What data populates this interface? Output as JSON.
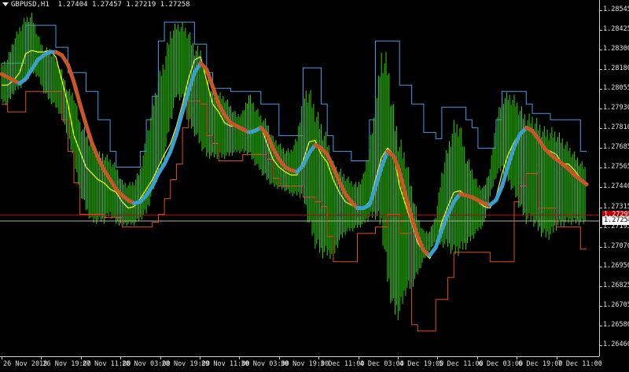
{
  "header": {
    "symbol_timeframe": "GBPUSD,H1",
    "ohlc": "1.27404 1.27457 1.27219 1.27258"
  },
  "price_axis": {
    "ticks": [
      "1.28545",
      "1.28425",
      "1.28300",
      "1.28180",
      "1.28055",
      "1.27930",
      "1.27810",
      "1.27685",
      "1.27565",
      "1.27440",
      "1.27315",
      "1.27195",
      "1.27070",
      "1.26950",
      "1.26825",
      "1.26705",
      "1.26580",
      "1.26460"
    ],
    "bid_label": "1.27258",
    "alert_label": "1.27295"
  },
  "time_axis": {
    "ticks": [
      "26 Nov 2018",
      "26 Nov 19:00",
      "27 Nov 11:00",
      "28 Nov 03:00",
      "28 Nov 19:00",
      "29 Nov 11:00",
      "30 Nov 03:00",
      "30 Nov 19:00",
      "3 Dec 11:00",
      "4 Dec 03:00",
      "4 Dec 19:00",
      "5 Dec 11:00",
      "6 Dec 03:00",
      "6 Dec 19:00",
      "7 Dec 11:00"
    ]
  },
  "colors": {
    "background": "#000000",
    "bars": "#2fd400",
    "yellow_band": "#ffff00",
    "blue_upper": "#3aa0e6",
    "red_lower": "#e0501a",
    "ma_orange": "#c8562a",
    "ma_blue": "#3a9dd4",
    "bid_line": "#b0b0b0",
    "alert_line": "#c00000",
    "axis_text": "#e0e0e0"
  },
  "chart_data": {
    "type": "line",
    "symbol": "GBPUSD",
    "timeframe": "H1",
    "y_range": [
      1.264,
      1.2866
    ],
    "x_labels": [
      "26 Nov 2018",
      "26 Nov 19:00",
      "27 Nov 11:00",
      "28 Nov 03:00",
      "28 Nov 19:00",
      "29 Nov 11:00",
      "30 Nov 03:00",
      "30 Nov 19:00",
      "3 Dec 11:00",
      "4 Dec 03:00",
      "4 Dec 19:00",
      "5 Dec 11:00",
      "6 Dec 03:00",
      "6 Dec 19:00",
      "7 Dec 11:00"
    ],
    "horizontal_lines": [
      {
        "name": "bid",
        "value": 1.27258
      },
      {
        "name": "alert",
        "value": 1.27295
      }
    ],
    "series": [
      {
        "kind": "ma_thick",
        "values": [
          1.2819,
          1.2817,
          1.2815,
          1.2813,
          1.2816,
          1.2822,
          1.2828,
          1.2831,
          1.2833,
          1.2833,
          1.2831,
          1.2825,
          1.2814,
          1.28,
          1.2787,
          1.2775,
          1.2766,
          1.2758,
          1.2752,
          1.2746,
          1.2742,
          1.2739,
          1.2737,
          1.2738,
          1.2742,
          1.2748,
          1.2756,
          1.2762,
          1.277,
          1.2781,
          1.2795,
          1.2808,
          1.282,
          1.2826,
          1.2822,
          1.2811,
          1.28,
          1.2793,
          1.2788,
          1.2786,
          1.2784,
          1.2782,
          1.2783,
          1.2785,
          1.2781,
          1.2772,
          1.2765,
          1.276,
          1.2758,
          1.2757,
          1.2761,
          1.2769,
          1.2774,
          1.2772,
          1.2768,
          1.276,
          1.2751,
          1.2743,
          1.2738,
          1.2734,
          1.2734,
          1.2736,
          1.2747,
          1.276,
          1.277,
          1.2767,
          1.2757,
          1.2742,
          1.2728,
          1.2716,
          1.2707,
          1.2704,
          1.2709,
          1.272,
          1.273,
          1.2738,
          1.2743,
          1.2742,
          1.2741,
          1.2739,
          1.2737,
          1.2736,
          1.2739,
          1.2748,
          1.2761,
          1.2773,
          1.2781,
          1.2785,
          1.2783,
          1.2778,
          1.2772,
          1.2768,
          1.2765,
          1.2762,
          1.2759,
          1.2755,
          1.2752,
          1.2749
        ]
      },
      {
        "kind": "yellow_band",
        "values": [
          1.2812,
          1.2812,
          1.2815,
          1.282,
          1.2832,
          1.2834,
          1.2833,
          1.2833,
          1.2834,
          1.283,
          1.2815,
          1.28,
          1.278,
          1.277,
          1.276,
          1.2756,
          1.2752,
          1.275,
          1.2746,
          1.2744,
          1.2738,
          1.2734,
          1.2735,
          1.274,
          1.2746,
          1.2752,
          1.276,
          1.2768,
          1.2775,
          1.2786,
          1.28,
          1.2816,
          1.2828,
          1.283,
          1.2815,
          1.28,
          1.2795,
          1.2788,
          1.2786,
          1.2786,
          1.2784,
          1.2782,
          1.2784,
          1.2786,
          1.2775,
          1.2765,
          1.276,
          1.2757,
          1.2755,
          1.2755,
          1.2764,
          1.2776,
          1.2777,
          1.2768,
          1.2763,
          1.2752,
          1.2744,
          1.2738,
          1.2736,
          1.2734,
          1.2734,
          1.2738,
          1.2752,
          1.2766,
          1.2772,
          1.2768,
          1.2748,
          1.2736,
          1.2724,
          1.2712,
          1.2706,
          1.2702,
          1.271,
          1.2725,
          1.2735,
          1.2744,
          1.2745,
          1.2742,
          1.274,
          1.2738,
          1.2735,
          1.2734,
          1.2741,
          1.2756,
          1.2768,
          1.2776,
          1.2782,
          1.2786,
          1.2784,
          1.2779,
          1.2772,
          1.277,
          1.2768,
          1.2762,
          1.2762,
          1.2758,
          1.2753,
          1.275
        ]
      },
      {
        "kind": "upper_band",
        "values": [
          1.2826,
          1.2826,
          1.2826,
          1.2826,
          1.285,
          1.285,
          1.285,
          1.285,
          1.285,
          1.2836,
          1.2836,
          1.282,
          1.282,
          1.282,
          1.2808,
          1.2808,
          1.279,
          1.279,
          1.277,
          1.276,
          1.276,
          1.276,
          1.276,
          1.277,
          1.279,
          1.2805,
          1.284,
          1.2852,
          1.2852,
          1.2852,
          1.2852,
          1.2852,
          1.2838,
          1.2838,
          1.282,
          1.281,
          1.281,
          1.281,
          1.2808,
          1.2808,
          1.2808,
          1.2808,
          1.2808,
          1.28,
          1.28,
          1.28,
          1.278,
          1.278,
          1.278,
          1.278,
          1.2823,
          1.2823,
          1.2823,
          1.28,
          1.278,
          1.277,
          1.277,
          1.277,
          1.2764,
          1.2764,
          1.2764,
          1.279,
          1.284,
          1.284,
          1.284,
          1.284,
          1.2812,
          1.2812,
          1.28,
          1.28,
          1.2782,
          1.2782,
          1.2778,
          1.2798,
          1.2798,
          1.2798,
          1.2798,
          1.279,
          1.2785,
          1.2772,
          1.2772,
          1.2772,
          1.279,
          1.2808,
          1.2808,
          1.2808,
          1.2808,
          1.28,
          1.2794,
          1.2794,
          1.2794,
          1.279,
          1.279,
          1.279,
          1.279,
          1.279,
          1.277,
          1.277
        ]
      },
      {
        "kind": "lower_band",
        "values": [
          1.28,
          1.2795,
          1.2795,
          1.2795,
          1.2808,
          1.2808,
          1.2808,
          1.2808,
          1.2808,
          1.2808,
          1.279,
          1.277,
          1.275,
          1.273,
          1.273,
          1.273,
          1.273,
          1.2728,
          1.2728,
          1.2728,
          1.2722,
          1.2722,
          1.2722,
          1.2722,
          1.2722,
          1.2725,
          1.273,
          1.274,
          1.2752,
          1.2762,
          1.2785,
          1.2802,
          1.2802,
          1.28,
          1.278,
          1.2775,
          1.2764,
          1.2764,
          1.2764,
          1.2764,
          1.2768,
          1.2768,
          1.2768,
          1.2768,
          1.2765,
          1.2753,
          1.2748,
          1.2748,
          1.2748,
          1.2748,
          1.2741,
          1.2741,
          1.2738,
          1.2735,
          1.2716,
          1.27,
          1.27,
          1.27,
          1.27,
          1.2718,
          1.2718,
          1.2718,
          1.2722,
          1.2722,
          1.273,
          1.273,
          1.2718,
          1.2718,
          1.266,
          1.2656,
          1.2656,
          1.2656,
          1.2676,
          1.2676,
          1.269,
          1.2706,
          1.2706,
          1.2706,
          1.2706,
          1.2706,
          1.2706,
          1.27,
          1.27,
          1.27,
          1.27,
          1.2738,
          1.2748,
          1.2756,
          1.2756,
          1.2734,
          1.2734,
          1.2734,
          1.2722,
          1.2722,
          1.2722,
          1.2722,
          1.2708,
          1.2708
        ]
      },
      {
        "kind": "bars_high",
        "values": [
          1.2826,
          1.283,
          1.2842,
          1.285,
          1.2856,
          1.2858,
          1.2845,
          1.2836,
          1.2836,
          1.283,
          1.2822,
          1.281,
          1.2808,
          1.279,
          1.2784,
          1.2776,
          1.277,
          1.277,
          1.2766,
          1.2762,
          1.2752,
          1.275,
          1.2752,
          1.276,
          1.278,
          1.28,
          1.2818,
          1.283,
          1.2848,
          1.2852,
          1.2852,
          1.2848,
          1.2838,
          1.2836,
          1.282,
          1.2808,
          1.2808,
          1.2806,
          1.28,
          1.2794,
          1.2796,
          1.2808,
          1.28,
          1.2794,
          1.279,
          1.278,
          1.2776,
          1.2772,
          1.2772,
          1.278,
          1.281,
          1.2812,
          1.28,
          1.279,
          1.278,
          1.2764,
          1.276,
          1.2756,
          1.2752,
          1.275,
          1.2756,
          1.2774,
          1.28,
          1.2836,
          1.2832,
          1.28,
          1.278,
          1.277,
          1.275,
          1.273,
          1.272,
          1.272,
          1.273,
          1.2758,
          1.2775,
          1.279,
          1.279,
          1.277,
          1.276,
          1.275,
          1.2748,
          1.276,
          1.279,
          1.2806,
          1.2808,
          1.2806,
          1.28,
          1.2794,
          1.2794,
          1.279,
          1.2786,
          1.2786,
          1.2784,
          1.278,
          1.2775,
          1.277,
          1.2765,
          1.276
        ]
      },
      {
        "kind": "bars_low",
        "values": [
          1.28,
          1.2798,
          1.2805,
          1.2808,
          1.2812,
          1.2818,
          1.2816,
          1.2806,
          1.28,
          1.2796,
          1.279,
          1.2778,
          1.276,
          1.2742,
          1.273,
          1.2722,
          1.2723,
          1.2723,
          1.2728,
          1.2722,
          1.2722,
          1.2722,
          1.2722,
          1.2725,
          1.2728,
          1.274,
          1.2752,
          1.2762,
          1.2785,
          1.2802,
          1.28,
          1.2785,
          1.2778,
          1.277,
          1.2764,
          1.2764,
          1.2764,
          1.2764,
          1.2766,
          1.2768,
          1.2768,
          1.2766,
          1.276,
          1.2755,
          1.275,
          1.2746,
          1.2745,
          1.2744,
          1.2741,
          1.274,
          1.2738,
          1.2718,
          1.2706,
          1.27,
          1.27,
          1.27,
          1.271,
          1.2716,
          1.2718,
          1.272,
          1.2722,
          1.2725,
          1.2725,
          1.2716,
          1.268,
          1.266,
          1.266,
          1.2676,
          1.268,
          1.269,
          1.27,
          1.2706,
          1.2712,
          1.2708,
          1.2706,
          1.27,
          1.2702,
          1.2706,
          1.2712,
          1.2718,
          1.2722,
          1.274,
          1.2752,
          1.2756,
          1.2748,
          1.274,
          1.273,
          1.2722,
          1.2722,
          1.2716,
          1.2712,
          1.2712,
          1.2718,
          1.272,
          1.2722,
          1.2722,
          1.2722,
          1.2722
        ]
      }
    ]
  }
}
